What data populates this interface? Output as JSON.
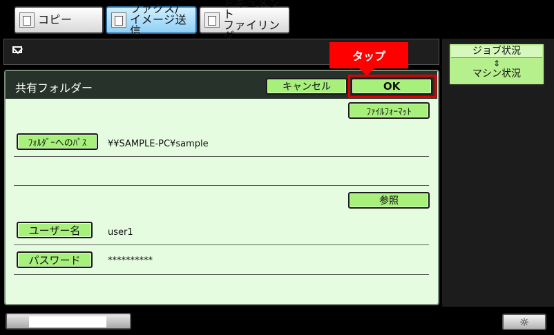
{
  "tabs": [
    {
      "label": "コピー",
      "icon": "copy-icon"
    },
    {
      "label": "ファクス/\nイメージ送信",
      "icon": "fax-icon"
    },
    {
      "label": "ドキュメント\nファイリング",
      "icon": "document-filing-icon"
    }
  ],
  "side": {
    "job_status": "ジョブ状況",
    "toggle_arrows": "⇕",
    "machine_status": "マシン状況"
  },
  "panel": {
    "title": "共有フォルダー",
    "cancel": "キャンセル",
    "ok": "OK",
    "file_format": "ﾌｧｲﾙﾌｫｰﾏｯﾄ",
    "folder_path_label": "ﾌｫﾙﾀﾞｰへのﾊﾟｽ",
    "folder_path_value": "¥¥SAMPLE-PC¥sample",
    "browse": "参照",
    "username_label": "ユーザー名",
    "username_value": "user1",
    "password_label": "パスワード",
    "password_value": "**********"
  },
  "annotation": {
    "tap": "タップ",
    "color": "#ff0000"
  },
  "bottom": {
    "brightness_icon": "☼"
  },
  "colors": {
    "button_green": "#a8f07c",
    "panel_bg": "#e6fce0",
    "active_tab": "#8fd0f5"
  }
}
